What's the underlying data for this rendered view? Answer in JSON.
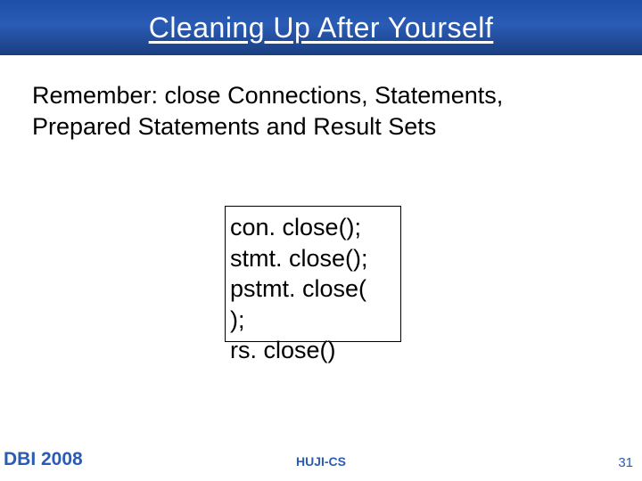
{
  "title": "Cleaning Up After Yourself",
  "body_line1": "Remember: close  Connections, Statements,",
  "body_line2": "Prepared Statements and Result Sets",
  "code": {
    "l1": "con. close();",
    "l2": "stmt. close();",
    "l3": "pstmt. close(",
    "l4": ");",
    "l5": "rs. close()"
  },
  "footer": {
    "left": "DBI 2008",
    "center": "HUJI-CS",
    "page": "31"
  }
}
